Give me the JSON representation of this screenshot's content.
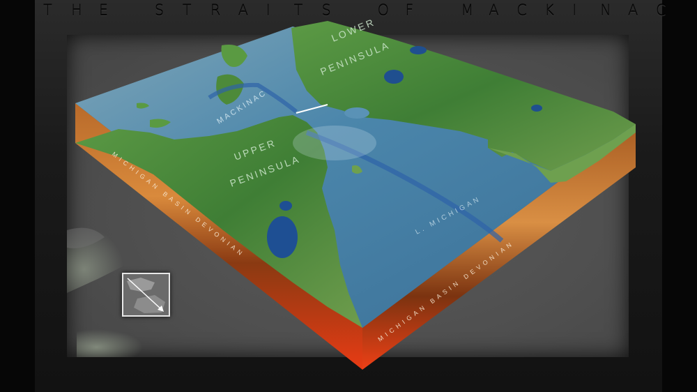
{
  "title": "THE STRAITS OF MACKINAC",
  "labels": {
    "lower_peninsula_1": "LOWER",
    "lower_peninsula_2": "PENINSULA",
    "upper_peninsula_1": "UPPER",
    "upper_peninsula_2": "PENINSULA",
    "mackinac": "MACKINAC",
    "lake_michigan": "L. MICHIGAN",
    "left_edge": "MICHIGAN BASIN DEVONIAN",
    "right_edge": "MICHIGAN BASIN DEVONIAN"
  },
  "colors": {
    "water": "#3f7fa3",
    "deep_water": "#2d63a8",
    "land": "#4f8a3c",
    "rock": "#c2531c",
    "frame": "#1a1a1a"
  },
  "inset": {
    "icon": "locator-arrow-icon"
  }
}
